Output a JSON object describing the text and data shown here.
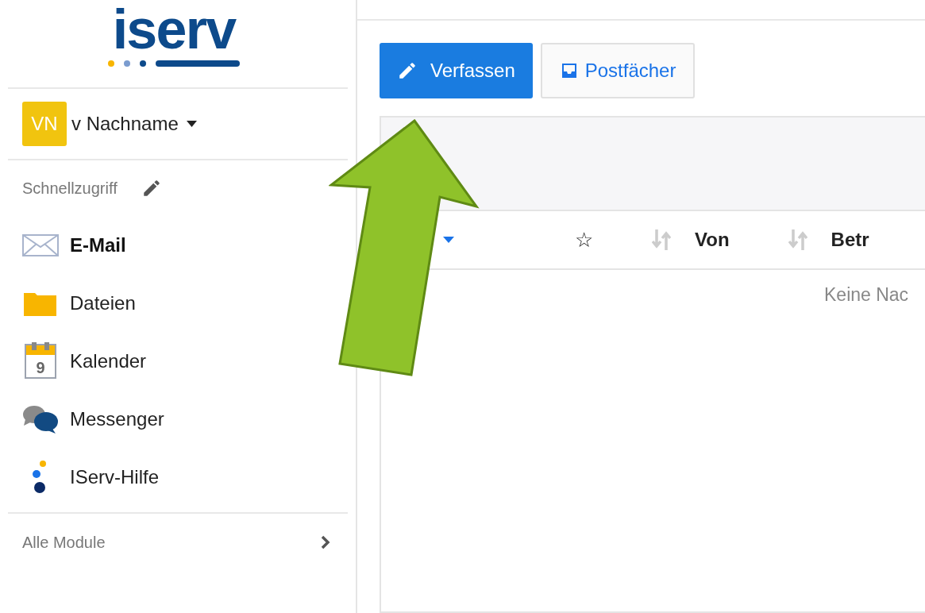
{
  "logo": "iserv",
  "user": {
    "initials": "VN",
    "name": "v Nachname"
  },
  "quick_access": {
    "title": "Schnellzugriff"
  },
  "sidebar": {
    "items": [
      {
        "kind": "mail",
        "label": "E-Mail",
        "selected": true
      },
      {
        "kind": "folder",
        "label": "Dateien",
        "selected": false
      },
      {
        "kind": "calendar",
        "label": "Kalender",
        "selected": false,
        "icon_text": "9"
      },
      {
        "kind": "chat",
        "label": "Messenger",
        "selected": false
      },
      {
        "kind": "help",
        "label": "IServ-Hilfe",
        "selected": false
      }
    ]
  },
  "all_modules": "Alle Module",
  "toolbar": {
    "buttons": [
      {
        "kind": "compose",
        "label": "Verfassen"
      },
      {
        "kind": "mailboxes",
        "label": "Postfächer"
      }
    ]
  },
  "table": {
    "columns": [
      {
        "kind": "star",
        "label": "☆"
      },
      {
        "kind": "sort",
        "label": "Von"
      },
      {
        "kind": "sort",
        "label": "Betr"
      }
    ],
    "empty": "Keine Nac"
  }
}
